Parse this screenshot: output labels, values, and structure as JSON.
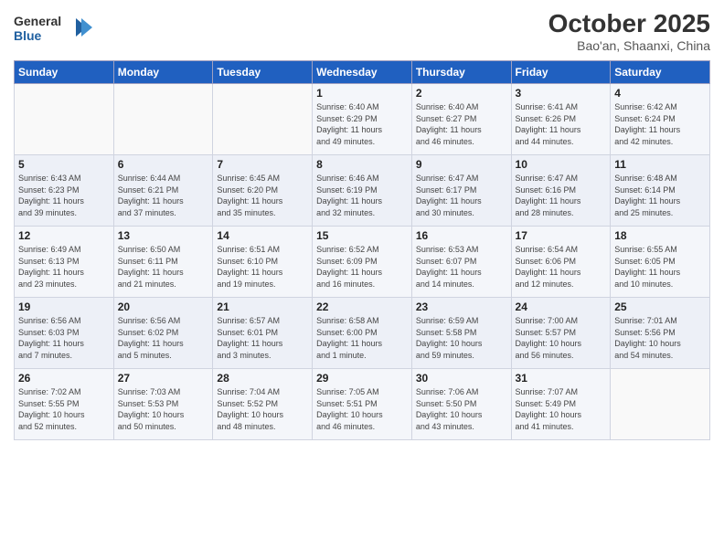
{
  "header": {
    "logo_line1": "General",
    "logo_line2": "Blue",
    "title": "October 2025",
    "subtitle": "Bao'an, Shaanxi, China"
  },
  "weekdays": [
    "Sunday",
    "Monday",
    "Tuesday",
    "Wednesday",
    "Thursday",
    "Friday",
    "Saturday"
  ],
  "weeks": [
    [
      {
        "day": "",
        "info": ""
      },
      {
        "day": "",
        "info": ""
      },
      {
        "day": "",
        "info": ""
      },
      {
        "day": "1",
        "info": "Sunrise: 6:40 AM\nSunset: 6:29 PM\nDaylight: 11 hours\nand 49 minutes."
      },
      {
        "day": "2",
        "info": "Sunrise: 6:40 AM\nSunset: 6:27 PM\nDaylight: 11 hours\nand 46 minutes."
      },
      {
        "day": "3",
        "info": "Sunrise: 6:41 AM\nSunset: 6:26 PM\nDaylight: 11 hours\nand 44 minutes."
      },
      {
        "day": "4",
        "info": "Sunrise: 6:42 AM\nSunset: 6:24 PM\nDaylight: 11 hours\nand 42 minutes."
      }
    ],
    [
      {
        "day": "5",
        "info": "Sunrise: 6:43 AM\nSunset: 6:23 PM\nDaylight: 11 hours\nand 39 minutes."
      },
      {
        "day": "6",
        "info": "Sunrise: 6:44 AM\nSunset: 6:21 PM\nDaylight: 11 hours\nand 37 minutes."
      },
      {
        "day": "7",
        "info": "Sunrise: 6:45 AM\nSunset: 6:20 PM\nDaylight: 11 hours\nand 35 minutes."
      },
      {
        "day": "8",
        "info": "Sunrise: 6:46 AM\nSunset: 6:19 PM\nDaylight: 11 hours\nand 32 minutes."
      },
      {
        "day": "9",
        "info": "Sunrise: 6:47 AM\nSunset: 6:17 PM\nDaylight: 11 hours\nand 30 minutes."
      },
      {
        "day": "10",
        "info": "Sunrise: 6:47 AM\nSunset: 6:16 PM\nDaylight: 11 hours\nand 28 minutes."
      },
      {
        "day": "11",
        "info": "Sunrise: 6:48 AM\nSunset: 6:14 PM\nDaylight: 11 hours\nand 25 minutes."
      }
    ],
    [
      {
        "day": "12",
        "info": "Sunrise: 6:49 AM\nSunset: 6:13 PM\nDaylight: 11 hours\nand 23 minutes."
      },
      {
        "day": "13",
        "info": "Sunrise: 6:50 AM\nSunset: 6:11 PM\nDaylight: 11 hours\nand 21 minutes."
      },
      {
        "day": "14",
        "info": "Sunrise: 6:51 AM\nSunset: 6:10 PM\nDaylight: 11 hours\nand 19 minutes."
      },
      {
        "day": "15",
        "info": "Sunrise: 6:52 AM\nSunset: 6:09 PM\nDaylight: 11 hours\nand 16 minutes."
      },
      {
        "day": "16",
        "info": "Sunrise: 6:53 AM\nSunset: 6:07 PM\nDaylight: 11 hours\nand 14 minutes."
      },
      {
        "day": "17",
        "info": "Sunrise: 6:54 AM\nSunset: 6:06 PM\nDaylight: 11 hours\nand 12 minutes."
      },
      {
        "day": "18",
        "info": "Sunrise: 6:55 AM\nSunset: 6:05 PM\nDaylight: 11 hours\nand 10 minutes."
      }
    ],
    [
      {
        "day": "19",
        "info": "Sunrise: 6:56 AM\nSunset: 6:03 PM\nDaylight: 11 hours\nand 7 minutes."
      },
      {
        "day": "20",
        "info": "Sunrise: 6:56 AM\nSunset: 6:02 PM\nDaylight: 11 hours\nand 5 minutes."
      },
      {
        "day": "21",
        "info": "Sunrise: 6:57 AM\nSunset: 6:01 PM\nDaylight: 11 hours\nand 3 minutes."
      },
      {
        "day": "22",
        "info": "Sunrise: 6:58 AM\nSunset: 6:00 PM\nDaylight: 11 hours\nand 1 minute."
      },
      {
        "day": "23",
        "info": "Sunrise: 6:59 AM\nSunset: 5:58 PM\nDaylight: 10 hours\nand 59 minutes."
      },
      {
        "day": "24",
        "info": "Sunrise: 7:00 AM\nSunset: 5:57 PM\nDaylight: 10 hours\nand 56 minutes."
      },
      {
        "day": "25",
        "info": "Sunrise: 7:01 AM\nSunset: 5:56 PM\nDaylight: 10 hours\nand 54 minutes."
      }
    ],
    [
      {
        "day": "26",
        "info": "Sunrise: 7:02 AM\nSunset: 5:55 PM\nDaylight: 10 hours\nand 52 minutes."
      },
      {
        "day": "27",
        "info": "Sunrise: 7:03 AM\nSunset: 5:53 PM\nDaylight: 10 hours\nand 50 minutes."
      },
      {
        "day": "28",
        "info": "Sunrise: 7:04 AM\nSunset: 5:52 PM\nDaylight: 10 hours\nand 48 minutes."
      },
      {
        "day": "29",
        "info": "Sunrise: 7:05 AM\nSunset: 5:51 PM\nDaylight: 10 hours\nand 46 minutes."
      },
      {
        "day": "30",
        "info": "Sunrise: 7:06 AM\nSunset: 5:50 PM\nDaylight: 10 hours\nand 43 minutes."
      },
      {
        "day": "31",
        "info": "Sunrise: 7:07 AM\nSunset: 5:49 PM\nDaylight: 10 hours\nand 41 minutes."
      },
      {
        "day": "",
        "info": ""
      }
    ]
  ]
}
